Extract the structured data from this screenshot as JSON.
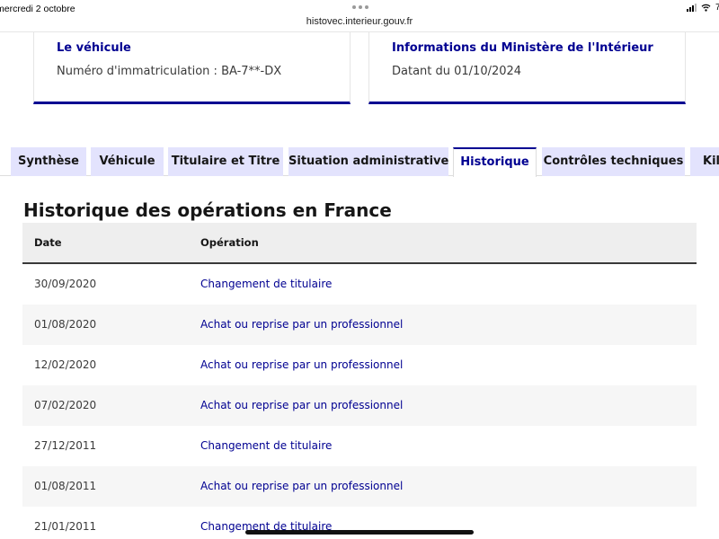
{
  "status_bar": {
    "date": "mercredi 2 octobre",
    "battery": "7"
  },
  "browser": {
    "url": "histovec.interieur.gouv.fr"
  },
  "cards": {
    "vehicle": {
      "title": "Le véhicule",
      "text": "Numéro d'immatriculation : BA-7**-DX"
    },
    "ministry": {
      "title": "Informations du Ministère de l'Intérieur",
      "text": "Datant du 01/10/2024"
    }
  },
  "tabs": [
    {
      "label": "Synthèse",
      "active": false
    },
    {
      "label": "Véhicule",
      "active": false
    },
    {
      "label": "Titulaire et Titre",
      "active": false
    },
    {
      "label": "Situation administrative",
      "active": false
    },
    {
      "label": "Historique",
      "active": true
    },
    {
      "label": "Contrôles techniques",
      "active": false
    },
    {
      "label": "Kilo",
      "active": false
    }
  ],
  "section": {
    "title": "Historique des opérations en France"
  },
  "table": {
    "headers": {
      "date": "Date",
      "operation": "Opération"
    },
    "rows": [
      {
        "date": "30/09/2020",
        "operation": "Changement de titulaire"
      },
      {
        "date": "01/08/2020",
        "operation": "Achat ou reprise par un professionnel"
      },
      {
        "date": "12/02/2020",
        "operation": "Achat ou reprise par un professionnel"
      },
      {
        "date": "07/02/2020",
        "operation": "Achat ou reprise par un professionnel"
      },
      {
        "date": "27/12/2011",
        "operation": "Changement de titulaire"
      },
      {
        "date": "01/08/2011",
        "operation": "Achat ou reprise par un professionnel"
      },
      {
        "date": "21/01/2011",
        "operation": "Changement de titulaire"
      }
    ]
  },
  "colors": {
    "accent": "#000091",
    "tab_background": "#e3e3fd",
    "row_stripe": "#f6f6f6",
    "header_background": "#eeeeee"
  }
}
